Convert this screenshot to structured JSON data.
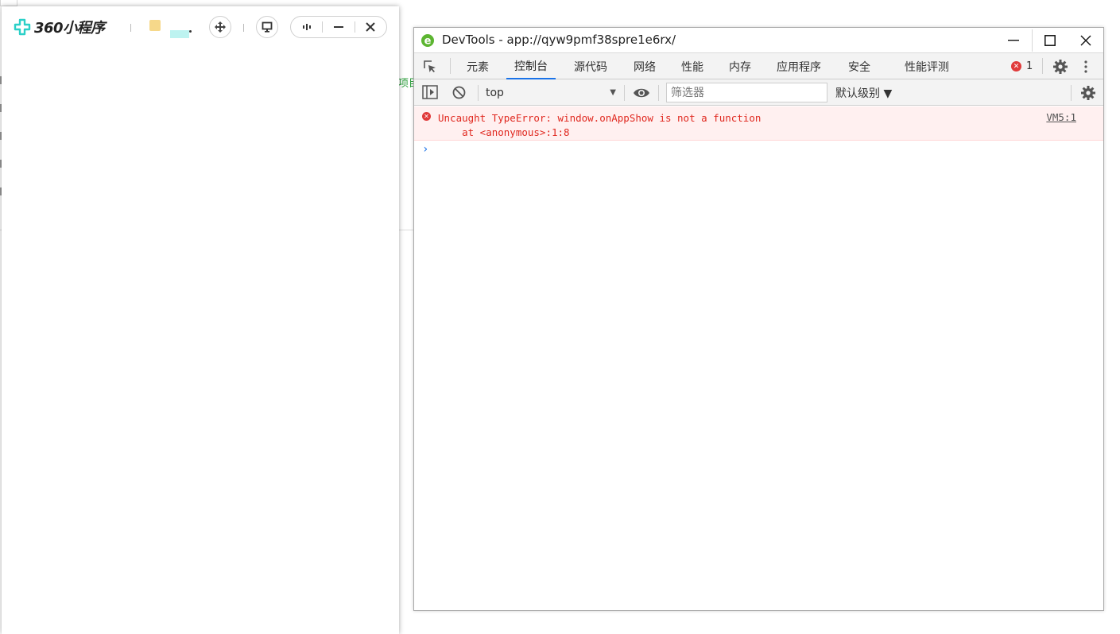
{
  "background": {
    "partial_link_text": "项目"
  },
  "miniprogram": {
    "brand_name": "360小程序"
  },
  "devtools": {
    "title": "DevTools - app://qyw9pmf38spre1e6rx/",
    "tabs": [
      "元素",
      "控制台",
      "源代码",
      "网络",
      "性能",
      "内存",
      "应用程序",
      "安全",
      "性能评测"
    ],
    "active_tab": "控制台",
    "error_count": "1",
    "context": "top",
    "filter_placeholder": "筛选器",
    "log_level": "默认级别 ▼",
    "console": {
      "error_line1": "Uncaught TypeError: window.onAppShow is not a function",
      "error_line2": "    at <anonymous>:1:8",
      "error_source": "VM5:1",
      "prompt": "›"
    }
  },
  "colors": {
    "accent": "#1a73e8",
    "error_text": "#e0281f",
    "error_bg": "#fff0f0",
    "brand_cyan": "#2bd0c8"
  }
}
